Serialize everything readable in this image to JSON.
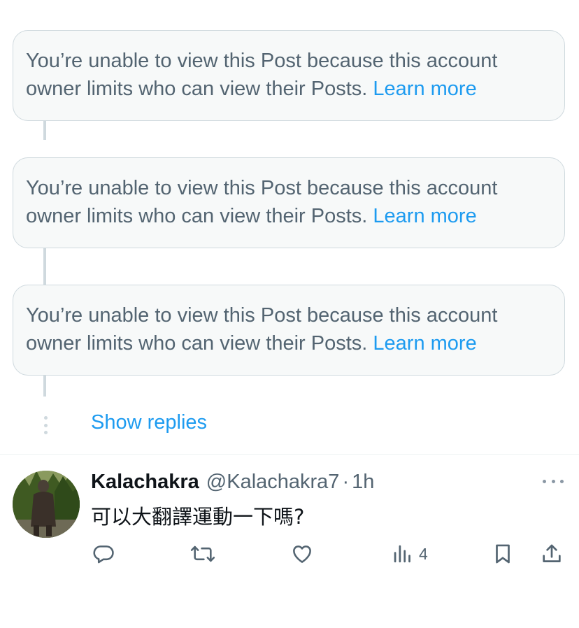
{
  "notices": [
    {
      "text": "You’re unable to view this Post because this account owner limits who can view their Posts.",
      "link": "Learn more"
    },
    {
      "text": "You’re unable to view this Post because this account owner limits who can view their Posts.",
      "link": "Learn more"
    },
    {
      "text": "You’re unable to view this Post because this account owner limits who can view their Posts.",
      "link": "Learn more"
    }
  ],
  "show_replies": "Show replies",
  "tweet": {
    "name": "Kalachakra",
    "handle": "@Kalachakra7",
    "separator": "·",
    "time": "1h",
    "text": "可以大翻譯運動一下嗎?",
    "views": "4"
  },
  "icons": {
    "reply": "reply-icon",
    "retweet": "retweet-icon",
    "like": "heart-icon",
    "views": "views-icon",
    "bookmark": "bookmark-icon",
    "share": "share-icon",
    "more": "more-icon"
  },
  "colors": {
    "link": "#1d9bf0",
    "secondary_text": "#536471",
    "primary_text": "#0f1419",
    "notice_bg": "#f7f9f9",
    "border": "#cfd9de"
  }
}
